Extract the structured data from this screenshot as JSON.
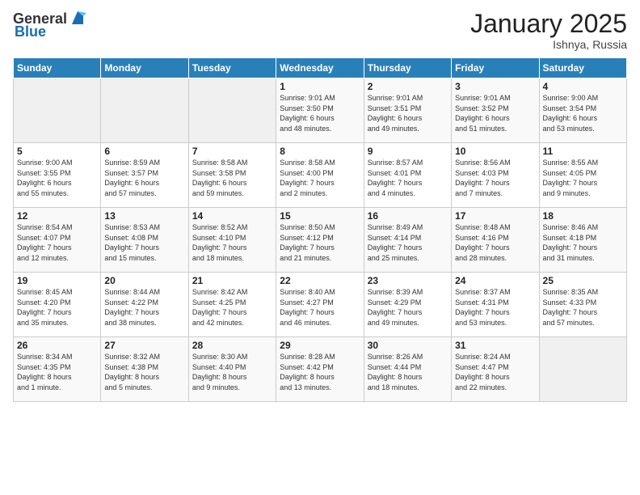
{
  "header": {
    "logo_general": "General",
    "logo_blue": "Blue",
    "month_title": "January 2025",
    "location": "Ishnya, Russia"
  },
  "weekdays": [
    "Sunday",
    "Monday",
    "Tuesday",
    "Wednesday",
    "Thursday",
    "Friday",
    "Saturday"
  ],
  "weeks": [
    [
      {
        "day": "",
        "info": ""
      },
      {
        "day": "",
        "info": ""
      },
      {
        "day": "",
        "info": ""
      },
      {
        "day": "1",
        "info": "Sunrise: 9:01 AM\nSunset: 3:50 PM\nDaylight: 6 hours\nand 48 minutes."
      },
      {
        "day": "2",
        "info": "Sunrise: 9:01 AM\nSunset: 3:51 PM\nDaylight: 6 hours\nand 49 minutes."
      },
      {
        "day": "3",
        "info": "Sunrise: 9:01 AM\nSunset: 3:52 PM\nDaylight: 6 hours\nand 51 minutes."
      },
      {
        "day": "4",
        "info": "Sunrise: 9:00 AM\nSunset: 3:54 PM\nDaylight: 6 hours\nand 53 minutes."
      }
    ],
    [
      {
        "day": "5",
        "info": "Sunrise: 9:00 AM\nSunset: 3:55 PM\nDaylight: 6 hours\nand 55 minutes."
      },
      {
        "day": "6",
        "info": "Sunrise: 8:59 AM\nSunset: 3:57 PM\nDaylight: 6 hours\nand 57 minutes."
      },
      {
        "day": "7",
        "info": "Sunrise: 8:58 AM\nSunset: 3:58 PM\nDaylight: 6 hours\nand 59 minutes."
      },
      {
        "day": "8",
        "info": "Sunrise: 8:58 AM\nSunset: 4:00 PM\nDaylight: 7 hours\nand 2 minutes."
      },
      {
        "day": "9",
        "info": "Sunrise: 8:57 AM\nSunset: 4:01 PM\nDaylight: 7 hours\nand 4 minutes."
      },
      {
        "day": "10",
        "info": "Sunrise: 8:56 AM\nSunset: 4:03 PM\nDaylight: 7 hours\nand 7 minutes."
      },
      {
        "day": "11",
        "info": "Sunrise: 8:55 AM\nSunset: 4:05 PM\nDaylight: 7 hours\nand 9 minutes."
      }
    ],
    [
      {
        "day": "12",
        "info": "Sunrise: 8:54 AM\nSunset: 4:07 PM\nDaylight: 7 hours\nand 12 minutes."
      },
      {
        "day": "13",
        "info": "Sunrise: 8:53 AM\nSunset: 4:08 PM\nDaylight: 7 hours\nand 15 minutes."
      },
      {
        "day": "14",
        "info": "Sunrise: 8:52 AM\nSunset: 4:10 PM\nDaylight: 7 hours\nand 18 minutes."
      },
      {
        "day": "15",
        "info": "Sunrise: 8:50 AM\nSunset: 4:12 PM\nDaylight: 7 hours\nand 21 minutes."
      },
      {
        "day": "16",
        "info": "Sunrise: 8:49 AM\nSunset: 4:14 PM\nDaylight: 7 hours\nand 25 minutes."
      },
      {
        "day": "17",
        "info": "Sunrise: 8:48 AM\nSunset: 4:16 PM\nDaylight: 7 hours\nand 28 minutes."
      },
      {
        "day": "18",
        "info": "Sunrise: 8:46 AM\nSunset: 4:18 PM\nDaylight: 7 hours\nand 31 minutes."
      }
    ],
    [
      {
        "day": "19",
        "info": "Sunrise: 8:45 AM\nSunset: 4:20 PM\nDaylight: 7 hours\nand 35 minutes."
      },
      {
        "day": "20",
        "info": "Sunrise: 8:44 AM\nSunset: 4:22 PM\nDaylight: 7 hours\nand 38 minutes."
      },
      {
        "day": "21",
        "info": "Sunrise: 8:42 AM\nSunset: 4:25 PM\nDaylight: 7 hours\nand 42 minutes."
      },
      {
        "day": "22",
        "info": "Sunrise: 8:40 AM\nSunset: 4:27 PM\nDaylight: 7 hours\nand 46 minutes."
      },
      {
        "day": "23",
        "info": "Sunrise: 8:39 AM\nSunset: 4:29 PM\nDaylight: 7 hours\nand 49 minutes."
      },
      {
        "day": "24",
        "info": "Sunrise: 8:37 AM\nSunset: 4:31 PM\nDaylight: 7 hours\nand 53 minutes."
      },
      {
        "day": "25",
        "info": "Sunrise: 8:35 AM\nSunset: 4:33 PM\nDaylight: 7 hours\nand 57 minutes."
      }
    ],
    [
      {
        "day": "26",
        "info": "Sunrise: 8:34 AM\nSunset: 4:35 PM\nDaylight: 8 hours\nand 1 minute."
      },
      {
        "day": "27",
        "info": "Sunrise: 8:32 AM\nSunset: 4:38 PM\nDaylight: 8 hours\nand 5 minutes."
      },
      {
        "day": "28",
        "info": "Sunrise: 8:30 AM\nSunset: 4:40 PM\nDaylight: 8 hours\nand 9 minutes."
      },
      {
        "day": "29",
        "info": "Sunrise: 8:28 AM\nSunset: 4:42 PM\nDaylight: 8 hours\nand 13 minutes."
      },
      {
        "day": "30",
        "info": "Sunrise: 8:26 AM\nSunset: 4:44 PM\nDaylight: 8 hours\nand 18 minutes."
      },
      {
        "day": "31",
        "info": "Sunrise: 8:24 AM\nSunset: 4:47 PM\nDaylight: 8 hours\nand 22 minutes."
      },
      {
        "day": "",
        "info": ""
      }
    ]
  ]
}
